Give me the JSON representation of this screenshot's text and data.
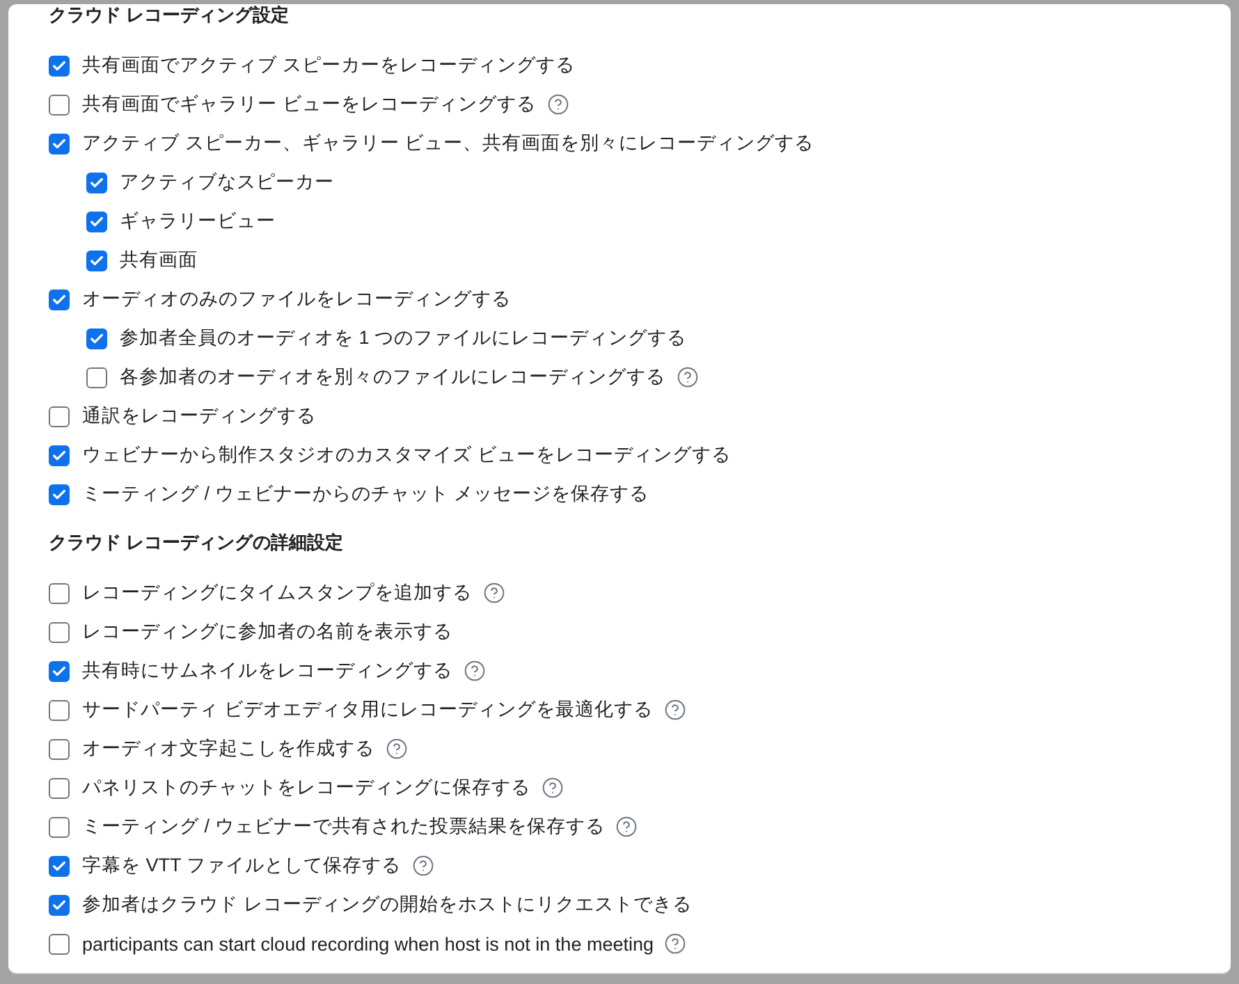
{
  "sections": [
    {
      "title": "クラウド レコーディング設定",
      "items": [
        {
          "label": "共有画面でアクティブ スピーカーをレコーディングする",
          "checked": true,
          "help": false
        },
        {
          "label": "共有画面でギャラリー ビューをレコーディングする",
          "checked": false,
          "help": true
        },
        {
          "label": "アクティブ スピーカー、ギャラリー ビュー、共有画面を別々にレコーディングする",
          "checked": true,
          "help": false,
          "children": [
            {
              "label": "アクティブなスピーカー",
              "checked": true,
              "help": false
            },
            {
              "label": "ギャラリービュー",
              "checked": true,
              "help": false
            },
            {
              "label": "共有画面",
              "checked": true,
              "help": false
            }
          ]
        },
        {
          "label": "オーディオのみのファイルをレコーディングする",
          "checked": true,
          "help": false,
          "children": [
            {
              "label": "参加者全員のオーディオを 1 つのファイルにレコーディングする",
              "checked": true,
              "help": false
            },
            {
              "label": "各参加者のオーディオを別々のファイルにレコーディングする",
              "checked": false,
              "help": true
            }
          ]
        },
        {
          "label": "通訳をレコーディングする",
          "checked": false,
          "help": false
        },
        {
          "label": "ウェビナーから制作スタジオのカスタマイズ ビューをレコーディングする",
          "checked": true,
          "help": false
        },
        {
          "label": "ミーティング / ウェビナーからのチャット メッセージを保存する",
          "checked": true,
          "help": false
        }
      ]
    },
    {
      "title": "クラウド レコーディングの詳細設定",
      "items": [
        {
          "label": "レコーディングにタイムスタンプを追加する",
          "checked": false,
          "help": true
        },
        {
          "label": "レコーディングに参加者の名前を表示する",
          "checked": false,
          "help": false
        },
        {
          "label": "共有時にサムネイルをレコーディングする",
          "checked": true,
          "help": true
        },
        {
          "label": "サードパーティ ビデオエディタ用にレコーディングを最適化する",
          "checked": false,
          "help": true
        },
        {
          "label": "オーディオ文字起こしを作成する",
          "checked": false,
          "help": true
        },
        {
          "label": "パネリストのチャットをレコーディングに保存する",
          "checked": false,
          "help": true
        },
        {
          "label": "ミーティング / ウェビナーで共有された投票結果を保存する",
          "checked": false,
          "help": true
        },
        {
          "label": "字幕を VTT ファイルとして保存する",
          "checked": true,
          "help": true
        },
        {
          "label": "参加者はクラウド レコーディングの開始をホストにリクエストできる",
          "checked": true,
          "help": false
        },
        {
          "label": "participants can start cloud recording when host is not in the meeting",
          "checked": false,
          "help": true
        }
      ]
    }
  ]
}
